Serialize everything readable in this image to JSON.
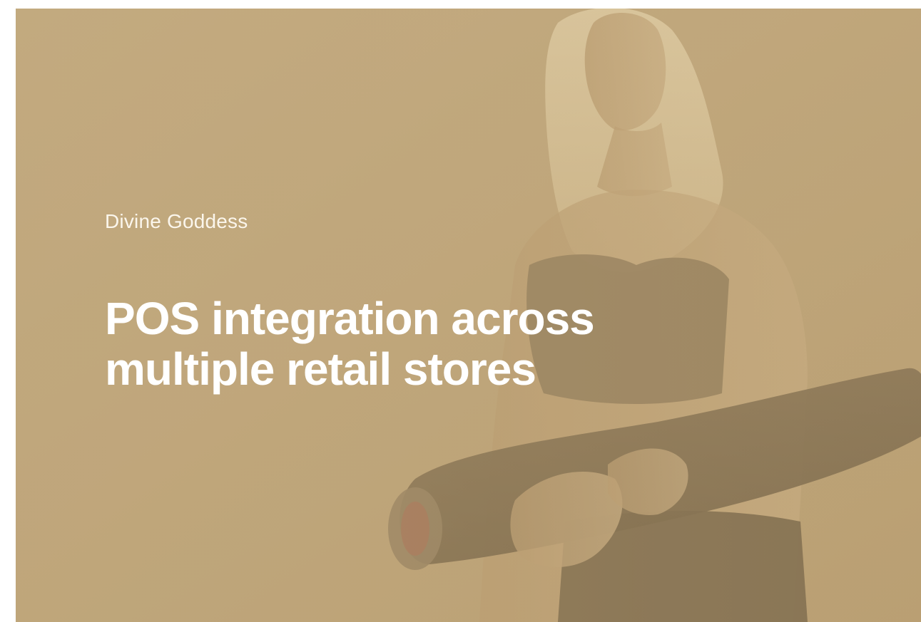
{
  "case_study": {
    "client_name": "Divine Goddess",
    "headline": "POS integration across multiple retail stores"
  },
  "hero_image": {
    "icon": "yoga-model-photo",
    "overlay_color": "#bfa67b"
  }
}
